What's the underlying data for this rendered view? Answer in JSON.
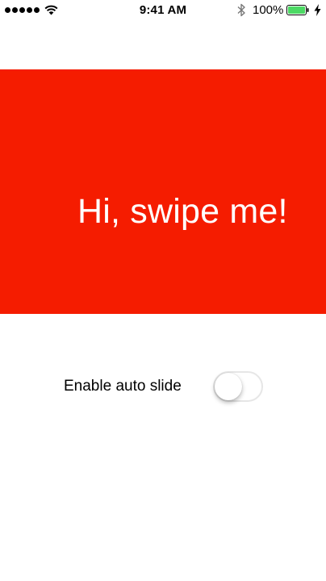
{
  "status_bar": {
    "time": "9:41 AM",
    "battery_percent": "100%",
    "signal_bars": 5,
    "battery_level": 1.0,
    "icons": [
      "signal-icon",
      "wifi-icon",
      "bluetooth-icon",
      "battery-icon",
      "charging-icon"
    ]
  },
  "slide": {
    "text": "Hi, swipe me!",
    "background_color": "#f51c00",
    "text_color": "#ffffff"
  },
  "auto_slide": {
    "label": "Enable auto slide",
    "enabled": false
  }
}
